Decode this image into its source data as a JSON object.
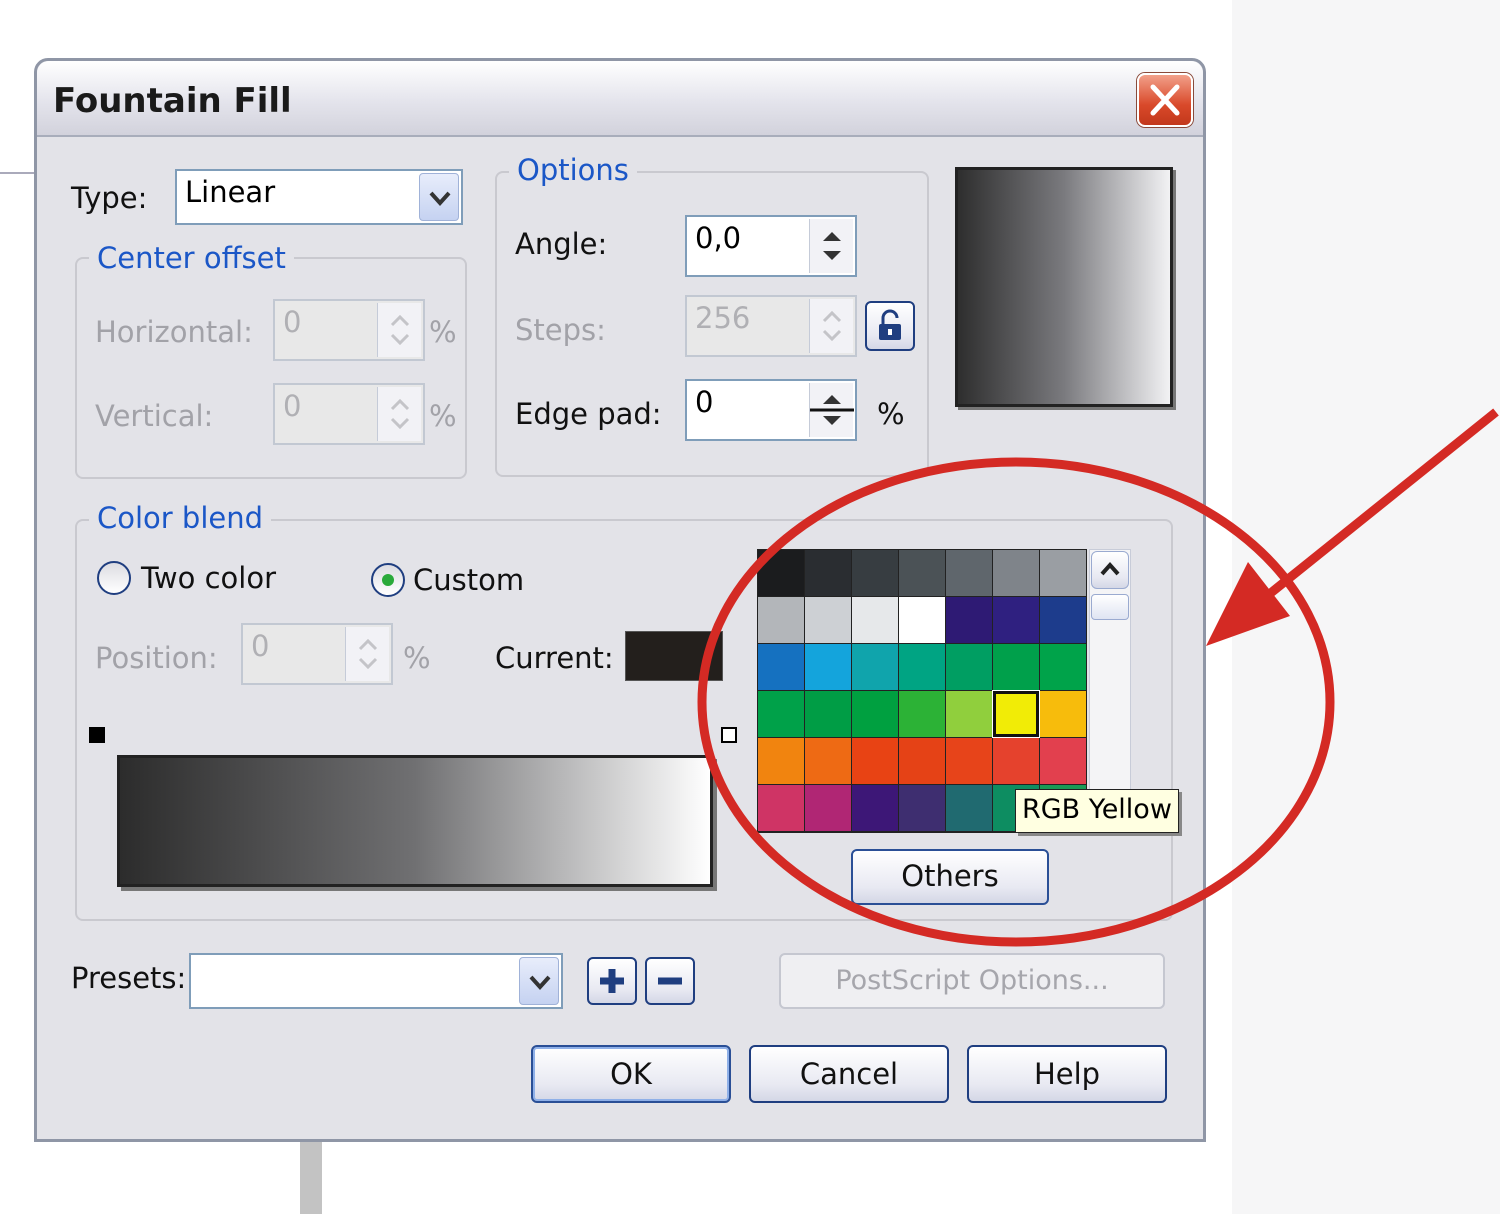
{
  "dialog": {
    "title": "Fountain Fill"
  },
  "type": {
    "label": "Type:",
    "value": "Linear"
  },
  "center_offset": {
    "title": "Center offset",
    "horizontal": {
      "label": "Horizontal:",
      "value": "0",
      "unit": "%"
    },
    "vertical": {
      "label": "Vertical:",
      "value": "0",
      "unit": "%"
    }
  },
  "options": {
    "title": "Options",
    "angle": {
      "label": "Angle:",
      "value": "0,0"
    },
    "steps": {
      "label": "Steps:",
      "value": "256"
    },
    "edge_pad": {
      "label": "Edge pad:",
      "value": "0",
      "unit": "%"
    }
  },
  "color_blend": {
    "title": "Color blend",
    "two_color": "Two color",
    "custom": "Custom",
    "selected_mode": "custom",
    "position": {
      "label": "Position:",
      "value": "0",
      "unit": "%"
    },
    "current": {
      "label": "Current:",
      "color": "#231f1c"
    }
  },
  "palette": {
    "rows": [
      [
        "#1b1c1e",
        "#2a2d31",
        "#373d41",
        "#4b5256",
        "#5f666c",
        "#7f848a",
        "#9a9ea3"
      ],
      [
        "#b3b6ba",
        "#cdd0d4",
        "#e6e8ea",
        "#ffffff",
        "#2e1a74",
        "#2f2080",
        "#1d3c8c"
      ],
      [
        "#1571c0",
        "#14a4dc",
        "#10a4ac",
        "#00a483",
        "#009e62",
        "#00a04b",
        "#00a34a"
      ],
      [
        "#00a149",
        "#009d45",
        "#00a040",
        "#2cb236",
        "#90cf3d",
        "#f1ec06",
        "#f7bc0c"
      ],
      [
        "#f1840f",
        "#ee6a14",
        "#e84314",
        "#e54216",
        "#e7441a",
        "#e5422d",
        "#e2404e"
      ],
      [
        "#cf3465",
        "#b02674",
        "#3d1777",
        "#3e2e70",
        "#206a70",
        "#0d8d61",
        "#1a9a56"
      ]
    ],
    "selected": "RGB Yellow",
    "others_label": "Others"
  },
  "presets": {
    "label": "Presets:",
    "value": ""
  },
  "postscript_label": "PostScript Options...",
  "buttons": {
    "ok": "OK",
    "cancel": "Cancel",
    "help": "Help"
  },
  "annotation_color": "#d42a24"
}
